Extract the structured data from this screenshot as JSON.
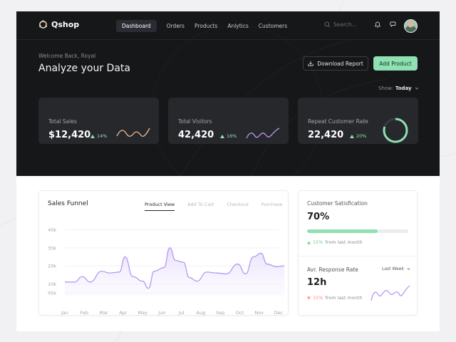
{
  "app": {
    "name": "Qshop"
  },
  "nav": {
    "links": [
      {
        "label": "Dashboard",
        "active": true
      },
      {
        "label": "Orders",
        "active": false
      },
      {
        "label": "Products",
        "active": false
      },
      {
        "label": "Anlytics",
        "active": false
      },
      {
        "label": "Customers",
        "active": false
      }
    ],
    "search_placeholder": "Search...",
    "icons": [
      "bell-icon",
      "chat-icon"
    ]
  },
  "header": {
    "welcome": "Welcome Back, Royal",
    "title": "Analyze your Data",
    "download_label": "Download Report",
    "add_label": "Add Product",
    "show_label": "Show:",
    "show_value": "Today"
  },
  "stats": [
    {
      "label": "Total Sales",
      "value": "$12,420",
      "change": "14%",
      "direction": "up",
      "spark_color": "#f2b98a"
    },
    {
      "label": "Total Visitors",
      "value": "42,420",
      "change": "16%",
      "direction": "up",
      "spark_color": "#b799f0"
    },
    {
      "label": "Repeat Customer Rate",
      "value": "22,420",
      "change": "20%",
      "direction": "up",
      "ring_color": "#8fe0b3",
      "ring_fraction": 0.8
    }
  ],
  "funnel": {
    "title": "Sales Funnel",
    "tabs": [
      {
        "label": "Product View",
        "active": true
      },
      {
        "label": "Add To Cart",
        "active": false
      },
      {
        "label": "Checkout",
        "active": false
      },
      {
        "label": "Purchase",
        "active": false
      }
    ]
  },
  "chart_data": {
    "type": "area",
    "title": "Sales Funnel",
    "x": [
      "Jan",
      "Feb",
      "Mar",
      "Apr",
      "May",
      "Jun",
      "Jul",
      "Aug",
      "Sep",
      "Oct",
      "Nov",
      "Dec"
    ],
    "yticks": [
      "40k",
      "30k",
      "20k",
      "10k",
      "05k"
    ],
    "ytick_values": [
      40,
      30,
      20,
      10,
      5
    ],
    "ylim": [
      3,
      43
    ],
    "series": [
      {
        "color": "#b799f0",
        "points": [
          [
            0,
            11
          ],
          [
            0.5,
            11
          ],
          [
            0.9,
            14
          ],
          [
            1.3,
            11
          ],
          [
            1.9,
            17
          ],
          [
            2.3,
            16
          ],
          [
            2.8,
            16.5
          ],
          [
            3.1,
            25
          ],
          [
            3.5,
            14
          ],
          [
            4.0,
            11.5
          ],
          [
            4.3,
            7.5
          ],
          [
            4.6,
            17
          ],
          [
            5.1,
            19
          ],
          [
            5.4,
            30
          ],
          [
            5.7,
            23
          ],
          [
            6.1,
            22
          ],
          [
            6.4,
            13.5
          ],
          [
            6.8,
            11.5
          ],
          [
            7.3,
            16.5
          ],
          [
            7.8,
            16
          ],
          [
            8.3,
            15.5
          ],
          [
            8.9,
            21
          ],
          [
            9.3,
            15.5
          ],
          [
            9.7,
            25
          ],
          [
            10.1,
            27
          ],
          [
            10.4,
            21
          ],
          [
            10.9,
            19.5
          ],
          [
            11.3,
            20
          ]
        ]
      }
    ],
    "grid": true
  },
  "satisfaction": {
    "title": "Customer Satisfication",
    "value": "70%",
    "fraction": 0.7,
    "change": "15%",
    "change_suffix": "from last month"
  },
  "response": {
    "title": "Avr. Response Rate",
    "period": "Last Week",
    "value": "12h",
    "change": "15%",
    "change_suffix": "from last month",
    "spark_color": "#b799f0"
  }
}
